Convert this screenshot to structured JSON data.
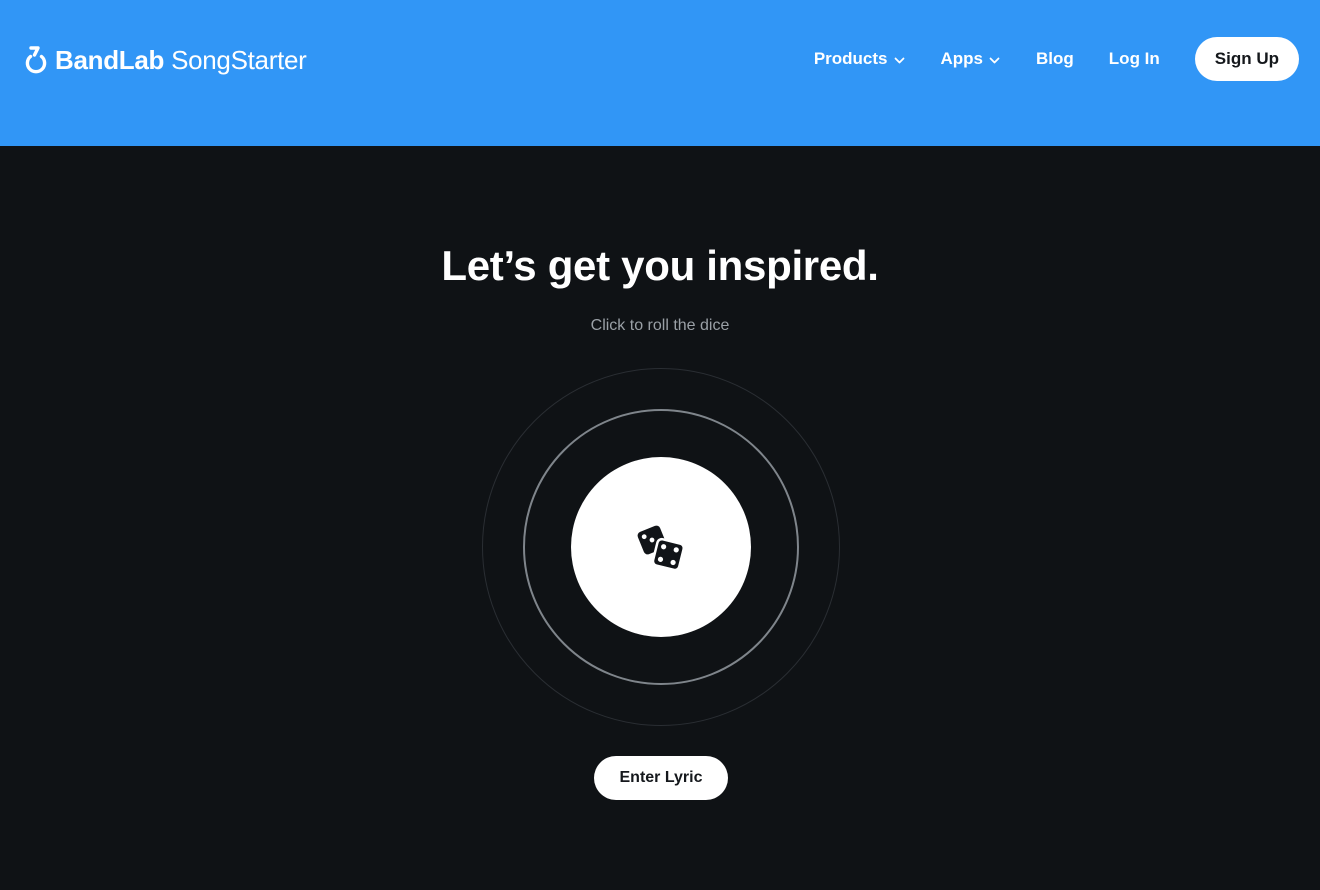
{
  "header": {
    "logo": {
      "brand": "BandLab",
      "product": "SongStarter",
      "icon": "bandlab-logo-icon"
    },
    "nav": {
      "products_label": "Products",
      "apps_label": "Apps",
      "blog_label": "Blog",
      "login_label": "Log In",
      "signup_label": "Sign Up"
    }
  },
  "main": {
    "headline": "Let’s get you inspired.",
    "subline": "Click to roll the dice",
    "dice_icon": "dice-icon",
    "lyric_button_label": "Enter Lyric"
  },
  "colors": {
    "header_bg": "#3196f6",
    "page_bg": "#0f1215",
    "text_primary": "#ffffff",
    "text_muted": "#9aa0a6"
  }
}
